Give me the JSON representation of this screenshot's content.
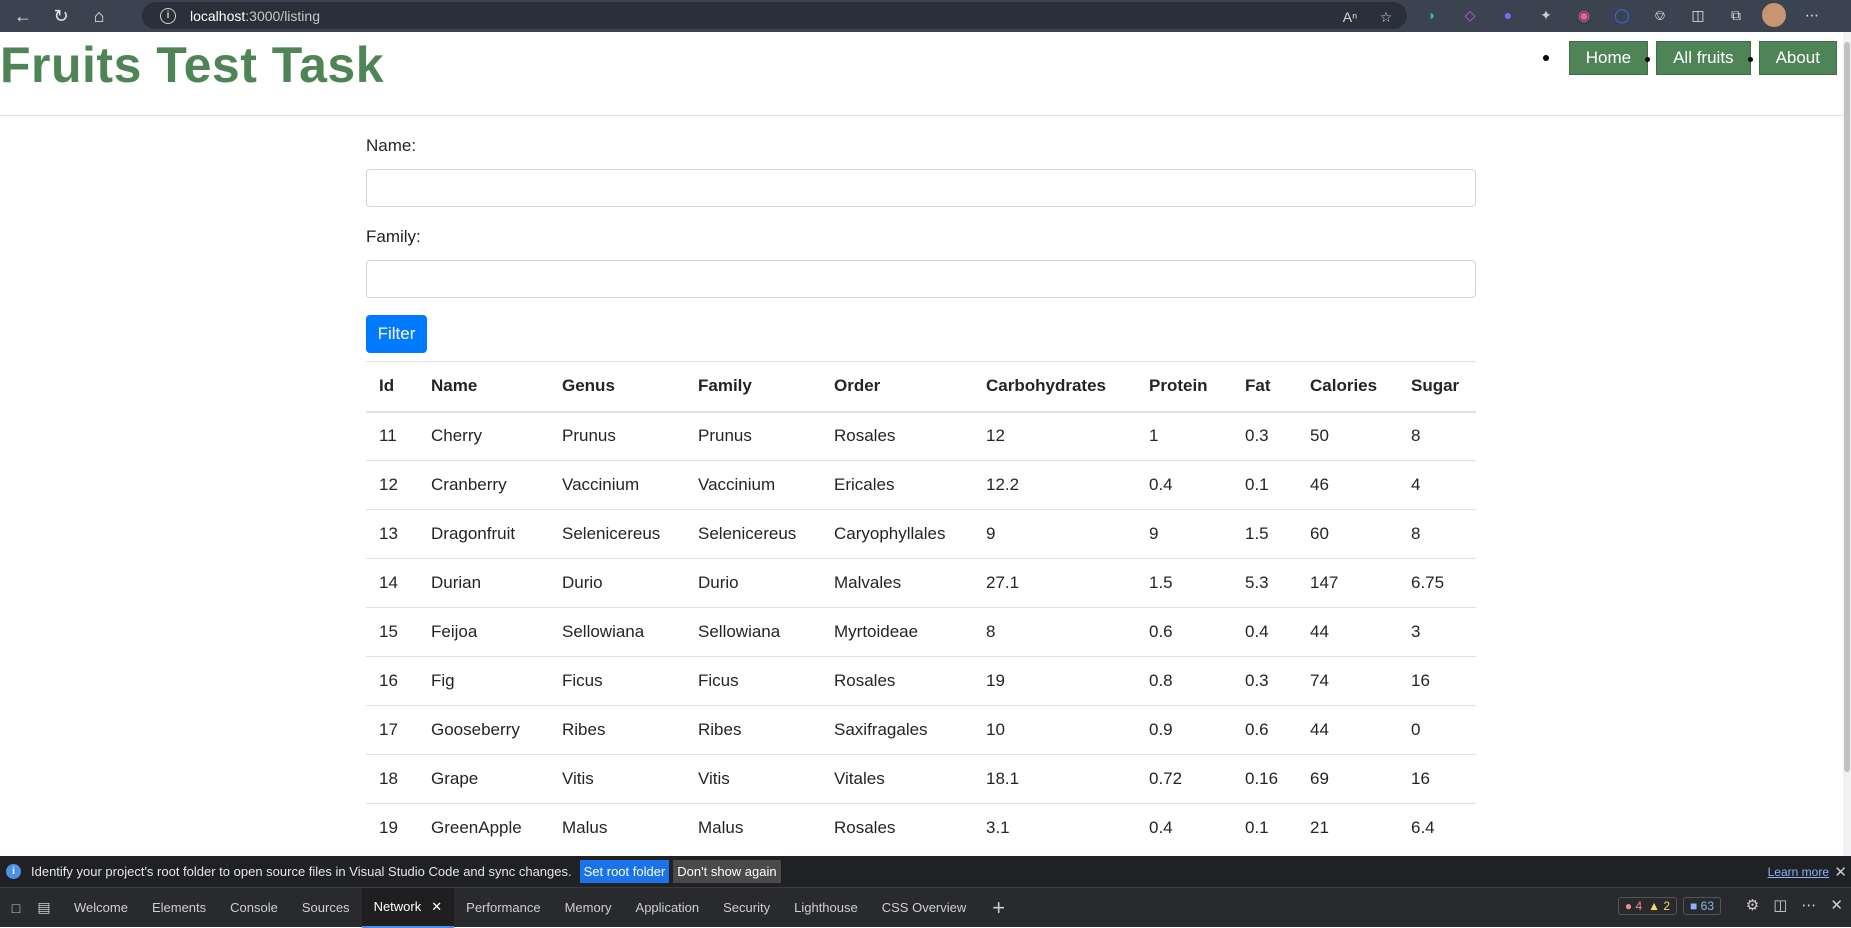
{
  "browser": {
    "url_host": "localhost",
    "url_path": ":3000/listing",
    "info_icon": "i"
  },
  "site": {
    "title": "Fruits Test Task",
    "nav": [
      "Home",
      "All fruits",
      "About"
    ]
  },
  "form": {
    "name_label": "Name:",
    "family_label": "Family:",
    "name_value": "",
    "family_value": "",
    "filter_label": "Filter"
  },
  "table": {
    "headers": [
      "Id",
      "Name",
      "Genus",
      "Family",
      "Order",
      "Carbohydrates",
      "Protein",
      "Fat",
      "Calories",
      "Sugar"
    ],
    "rows": [
      [
        "11",
        "Cherry",
        "Prunus",
        "Prunus",
        "Rosales",
        "12",
        "1",
        "0.3",
        "50",
        "8"
      ],
      [
        "12",
        "Cranberry",
        "Vaccinium",
        "Vaccinium",
        "Ericales",
        "12.2",
        "0.4",
        "0.1",
        "46",
        "4"
      ],
      [
        "13",
        "Dragonfruit",
        "Selenicereus",
        "Selenicereus",
        "Caryophyllales",
        "9",
        "9",
        "1.5",
        "60",
        "8"
      ],
      [
        "14",
        "Durian",
        "Durio",
        "Durio",
        "Malvales",
        "27.1",
        "1.5",
        "5.3",
        "147",
        "6.75"
      ],
      [
        "15",
        "Feijoa",
        "Sellowiana",
        "Sellowiana",
        "Myrtoideae",
        "8",
        "0.6",
        "0.4",
        "44",
        "3"
      ],
      [
        "16",
        "Fig",
        "Ficus",
        "Ficus",
        "Rosales",
        "19",
        "0.8",
        "0.3",
        "74",
        "16"
      ],
      [
        "17",
        "Gooseberry",
        "Ribes",
        "Ribes",
        "Saxifragales",
        "10",
        "0.9",
        "0.6",
        "44",
        "0"
      ],
      [
        "18",
        "Grape",
        "Vitis",
        "Vitis",
        "Vitales",
        "18.1",
        "0.72",
        "0.16",
        "69",
        "16"
      ],
      [
        "19",
        "GreenApple",
        "Malus",
        "Malus",
        "Rosales",
        "3.1",
        "0.4",
        "0.1",
        "21",
        "6.4"
      ]
    ]
  },
  "notification": {
    "text": "Identify your project's root folder to open source files in Visual Studio Code and sync changes.",
    "set_root": "Set root folder",
    "dont_show": "Don't show again",
    "learn_more": "Learn more"
  },
  "devtools": {
    "tabs": [
      "Welcome",
      "Elements",
      "Console",
      "Sources",
      "Network",
      "Performance",
      "Memory",
      "Application",
      "Security",
      "Lighthouse",
      "CSS Overview"
    ],
    "active_tab": "Network",
    "errors": "4",
    "warnings": "2",
    "messages": "63"
  },
  "colors": {
    "brand_green": "#4e8456",
    "filter_blue": "#007bff"
  }
}
